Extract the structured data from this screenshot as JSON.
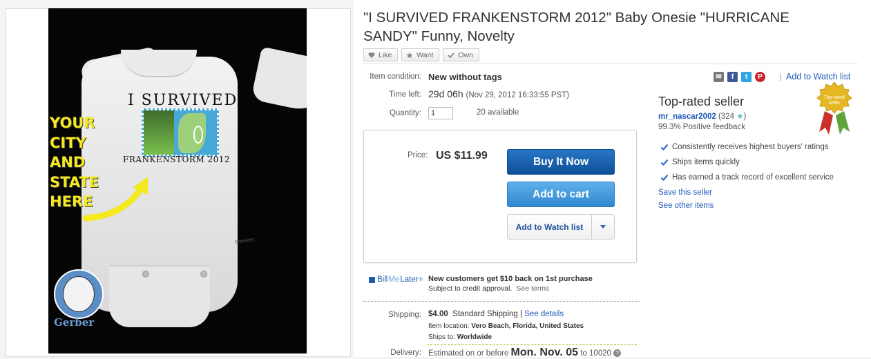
{
  "item": {
    "title": "\"I SURVIVED FRANKENSTORM 2012\" Baby Onesie \"HURRICANE SANDY\" Funny, Novelty"
  },
  "actions": [
    {
      "label": "Like",
      "icon": "heart-icon"
    },
    {
      "label": "Want",
      "icon": "star-icon"
    },
    {
      "label": "Own",
      "icon": "check-icon"
    }
  ],
  "product_image": {
    "headline": "I SURVIVED",
    "caption": "FRANKENSTORM 2012",
    "overlay_lines": [
      "YOUR",
      "CITY",
      "AND",
      "STATE",
      "HERE"
    ],
    "brand": "Gerber",
    "tag": "onesies"
  },
  "details": {
    "condition_label": "Item condition:",
    "condition_value": "New without tags",
    "timeleft_label": "Time left:",
    "timeleft_value": "29d 06h",
    "timeleft_sub": "(Nov 29, 2012  16:33:55 PST)",
    "quantity_label": "Quantity:",
    "quantity_value": "1",
    "available": "20 available"
  },
  "buy_box": {
    "price_label": "Price:",
    "price_value": "US $11.99",
    "buy_now": "Buy It Now",
    "add_to_cart": "Add to cart",
    "add_to_watch": "Add to Watch list"
  },
  "bill_me_later": {
    "logo_bill": "Bill",
    "logo_me": "Me",
    "logo_later": "Later",
    "logo_mark": "®",
    "headline": "New customers get $10 back on 1st purchase",
    "subtext": "Subject to credit approval.",
    "see_terms": "See terms"
  },
  "shipping": {
    "label": "Shipping:",
    "cost": "$4.00",
    "method": "Standard Shipping |",
    "details_link": "See details",
    "location_label": "Item location:",
    "location_value": "Vero Beach, Florida, United States",
    "ships_to_label": "Ships to:",
    "ships_to_value": "Worldwide"
  },
  "delivery": {
    "label": "Delivery:",
    "prefix": "Estimated on or before",
    "date": "Mon. Nov. 05",
    "suffix": "to 10020"
  },
  "seller": {
    "watch_link": "Add to Watch list",
    "pipe": "|",
    "heading": "Top-rated seller",
    "name": "mr_nascar2002",
    "score": "(324",
    "score_close": ")",
    "feedback": "99.3% Positive feedback",
    "badge_text_1": "Top-rated",
    "badge_text_2": "seller",
    "features": [
      "Consistently receives highest buyers' ratings",
      "Ships items quickly",
      "Has earned a track record of excellent service"
    ],
    "save_link": "Save this seller",
    "other_link": "See other items"
  },
  "social": [
    {
      "icon": "email-icon",
      "glyph": "✉"
    },
    {
      "icon": "facebook-icon",
      "glyph": "f"
    },
    {
      "icon": "twitter-icon",
      "glyph": "t"
    },
    {
      "icon": "pinterest-icon",
      "glyph": "P"
    }
  ],
  "colors": {
    "link": "#1d58b8",
    "buy_now": "#1359a8",
    "add_to_cart": "#3d94d8",
    "badge_gold": "#e6b724"
  }
}
